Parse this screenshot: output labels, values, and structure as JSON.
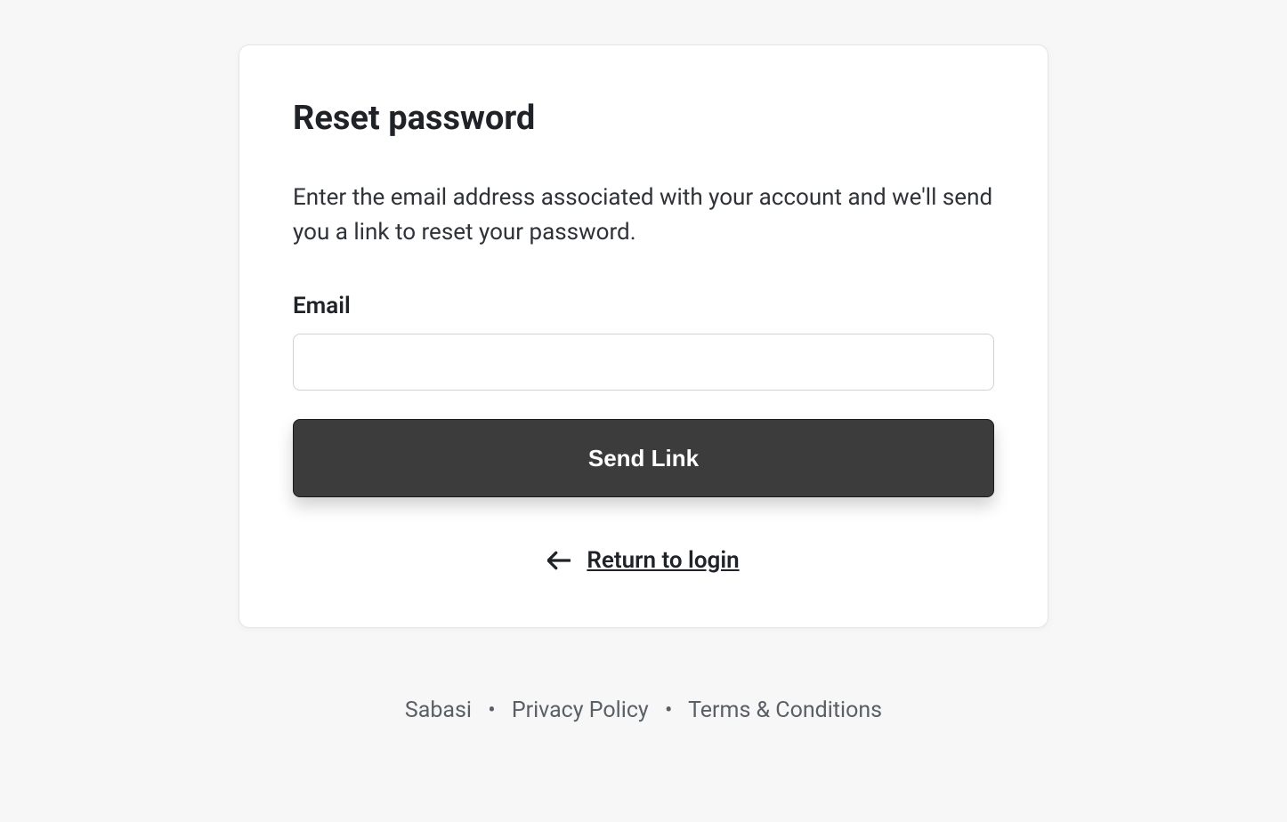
{
  "card": {
    "title": "Reset password",
    "description": "Enter the email address associated with your account and we'll send you a link to reset your password.",
    "emailLabel": "Email",
    "emailValue": "",
    "sendButton": "Send Link",
    "returnLink": "Return to login"
  },
  "footer": {
    "brand": "Sabasi",
    "privacy": "Privacy Policy",
    "terms": "Terms & Conditions",
    "separator": "•"
  }
}
